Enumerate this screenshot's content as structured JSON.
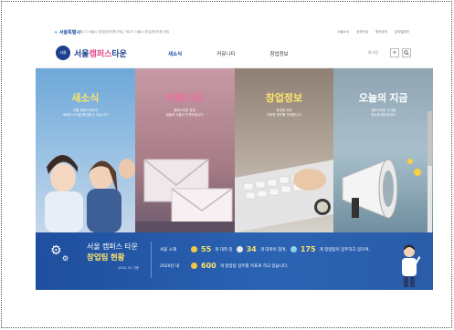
{
  "topbar": {
    "seoul_logo": "서울특별시",
    "notice": "제1기 서울시 창업공간지원 모집 / 제2기 서울시 창업공간지원 모집",
    "utils": [
      "서울소식",
      "공모안내",
      "정보공개",
      "분야별정보"
    ]
  },
  "header": {
    "badge": "서울",
    "brand_main": "서울",
    "brand_accent": "캠퍼스",
    "brand_tail": "타운",
    "nav": [
      "새소식",
      "커뮤니티",
      "창업정보"
    ],
    "login": "로그인"
  },
  "panels": [
    {
      "title": "새소식",
      "desc1": "서울 캠퍼스타운의",
      "desc2": "새로운 소식을 확인할 수 있습니다"
    },
    {
      "title": "커뮤니티",
      "desc1": "캠퍼스타운 창업",
      "desc2": "팀들과 소통이 이루어집니다"
    },
    {
      "title": "창업정보",
      "desc1": "창업에 관한",
      "desc2": "다양한 정보를 안내합니다"
    },
    {
      "title": "오늘의 지금",
      "desc1": "캠퍼스타운 소식을",
      "desc2": "한눈에 확인하세요"
    }
  ],
  "banner": {
    "title1": "서울 캠퍼스 타운",
    "title2": "창업팀 현황",
    "date": "2020. 01 기준",
    "row1_label": "서울 소재",
    "n_univ": "55",
    "t_univ": "개 대학 중",
    "n_join": "34",
    "t_join": "개 대학이 참여,",
    "n_teams": "175",
    "t_teams": "개 창업팀이 입주하고 있으며,",
    "row2_label": "2020년 내",
    "n_goal": "600",
    "t_goal": "개 창업팀 입주를 목표로 하고 있습니다."
  },
  "colors": {
    "brand": "#1d3f8f",
    "accent": "#e2498a",
    "highlight": "#fce46b",
    "banner": "#2b63b3"
  }
}
